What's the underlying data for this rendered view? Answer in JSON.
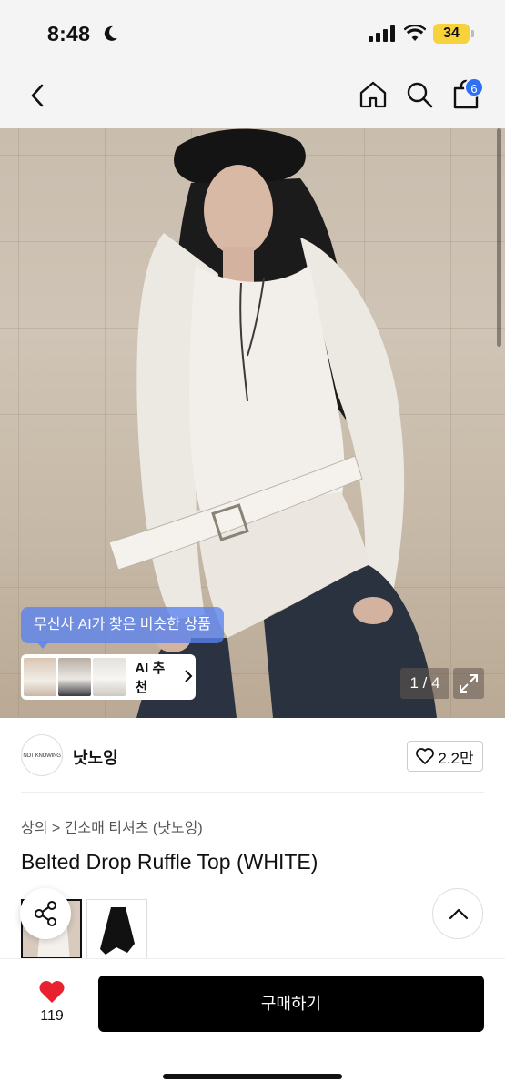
{
  "status_bar": {
    "time": "8:48",
    "battery": "34"
  },
  "nav": {
    "cart_count": "6"
  },
  "hero": {
    "ai_prompt": "무신사 AI가 찾은 비슷한 상품",
    "ai_button_label": "AI 추천",
    "image_counter": "1 / 4"
  },
  "brand": {
    "logo_text": "NOT KNOWING",
    "name": "낫노잉",
    "likes": "2.2만"
  },
  "product": {
    "breadcrumb": "상의 > 긴소매 티셔츠 (낫노잉)",
    "title": "Belted Drop Ruffle Top (WHITE)"
  },
  "bottom_bar": {
    "like_count": "119",
    "buy_label": "구매하기"
  },
  "colors": {
    "accent_blue": "#2f6ff3",
    "heart_red": "#e8222f",
    "buy_black": "#000000"
  }
}
